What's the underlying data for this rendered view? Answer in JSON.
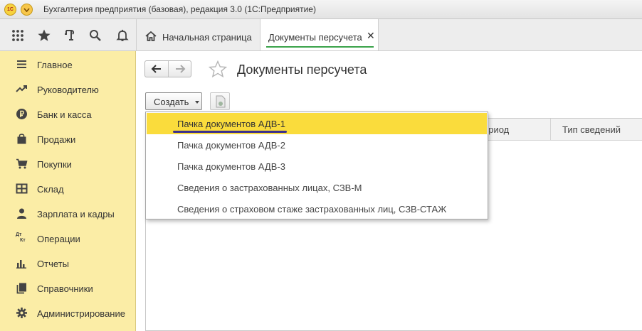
{
  "window": {
    "title": "Бухгалтерия предприятия (базовая), редакция 3.0  (1С:Предприятие)",
    "logo_text": "1С"
  },
  "toolbar": {
    "icons": [
      "apps-grid-icon",
      "star-icon",
      "history-icon",
      "search-icon",
      "bell-icon"
    ]
  },
  "tabs": [
    {
      "label": "Начальная страница",
      "icon": "home-icon",
      "active": false
    },
    {
      "label": "Документы персучета",
      "active": true,
      "closable": true
    }
  ],
  "sidebar": {
    "items": [
      {
        "label": "Главное",
        "icon": "menu-lines-icon"
      },
      {
        "label": "Руководителю",
        "icon": "trend-icon"
      },
      {
        "label": "Банк и касса",
        "icon": "ruble-icon"
      },
      {
        "label": "Продажи",
        "icon": "shopping-bag-icon"
      },
      {
        "label": "Покупки",
        "icon": "cart-icon"
      },
      {
        "label": "Склад",
        "icon": "warehouse-grid-icon"
      },
      {
        "label": "Зарплата и кадры",
        "icon": "person-icon"
      },
      {
        "label": "Операции",
        "icon": "debit-credit-icon"
      },
      {
        "label": "Отчеты",
        "icon": "bar-chart-icon"
      },
      {
        "label": "Справочники",
        "icon": "books-icon"
      },
      {
        "label": "Администрирование",
        "icon": "gear-icon"
      }
    ],
    "dtkt_top": "Дт",
    "dtkt_bottom": "Кт"
  },
  "page": {
    "title": "Документы персучета",
    "create_label": "Создать"
  },
  "table": {
    "columns": [
      "ериод",
      "Тип сведений"
    ]
  },
  "dropdown": {
    "items": [
      "Пачка документов АДВ-1",
      "Пачка документов АДВ-2",
      "Пачка документов АДВ-3",
      "Сведения о застрахованных лицах, СЗВ-М",
      "Сведения о страховом стаже застрахованных лиц, СЗВ-СТАЖ"
    ],
    "highlighted_index": 0,
    "highlight_color": "#fadc3c"
  },
  "colors": {
    "sidebar_bg": "#fbeda6",
    "active_tab_underline": "#3aa34a",
    "annotation_underline": "#3a2f8e"
  }
}
